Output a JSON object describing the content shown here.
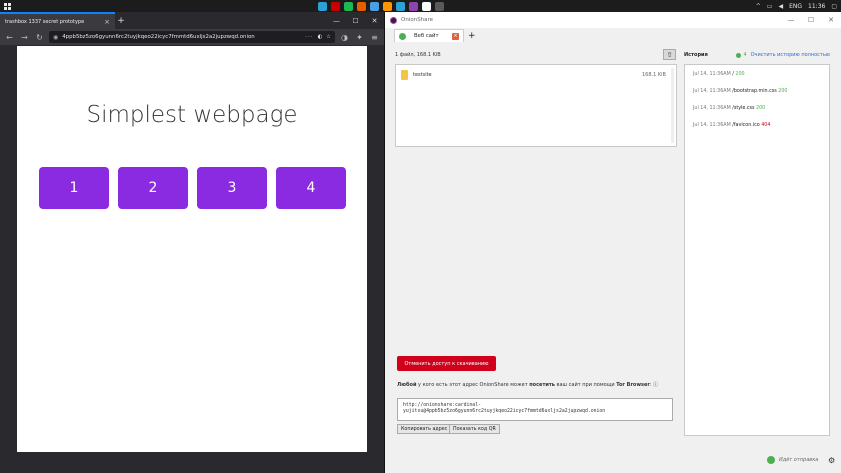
{
  "taskbar": {
    "tray_lang": "ENG",
    "clock": "11:36",
    "apps": [
      "#2aa2d7",
      "#c90000",
      "#1db954",
      "#e66000",
      "#4aa0e6",
      "#ff9500",
      "#2aa2d7",
      "#8e44ad",
      "#ffffff",
      "#5a5a5a"
    ]
  },
  "browser": {
    "tab_title": "trashbox 1337 secret prototype",
    "url": "4ppb5bz5zo6gyunn6rc2tuyjkqeo22icyc7fmmtd6uxljs2a2jupzwqd.onion",
    "page": {
      "heading": "Simplest webpage",
      "tiles": [
        "1",
        "2",
        "3",
        "4"
      ]
    }
  },
  "onionshare": {
    "window_title": "OnionShare",
    "tab_label": "Веб сайт",
    "files_info": "1 файл, 168.1 KiB",
    "files": [
      {
        "name": "testsite",
        "size": "168.1 KiB"
      }
    ],
    "stop_label": "Отменить доступ к скачиванию",
    "share_text_1": "Любой",
    "share_text_2": " у кого есть этот адрес OnionShare может ",
    "share_text_3": "посетить",
    "share_text_4": " ваш сайт при помощи ",
    "share_text_5": "Tor Browser",
    "share_text_6": ": ⓘ",
    "url_line1": "http://onionshare:cardinal-",
    "url_line2": "yujitsu@4ppb5bz5zo6gyunn6rc2tuyjkqeo22icyc7fmmtd6uxljs2a2jupzwqd.onion",
    "copy_label": "Копировать адрес",
    "qr_label": "Показать код QR",
    "history_title": "История",
    "history_count": "4",
    "history_clear": "Очистить историю полностью",
    "history": [
      {
        "time": "Jul 14, 11:36AM",
        "path": "/",
        "status": "200"
      },
      {
        "time": "Jul 14, 11:36AM",
        "path": "/bootstrap.min.css",
        "status": "200"
      },
      {
        "time": "Jul 14, 11:36AM",
        "path": "/style.css",
        "status": "200"
      },
      {
        "time": "Jul 14, 11:36AM",
        "path": "/favicon.ico",
        "status": "404"
      }
    ],
    "status_text": "Идёт отправка"
  }
}
